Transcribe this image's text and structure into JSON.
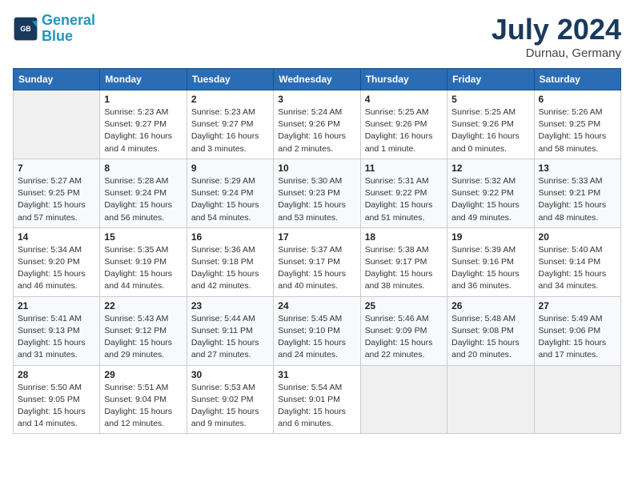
{
  "header": {
    "logo_line1": "General",
    "logo_line2": "Blue",
    "month_year": "July 2024",
    "location": "Durnau, Germany"
  },
  "columns": [
    "Sunday",
    "Monday",
    "Tuesday",
    "Wednesday",
    "Thursday",
    "Friday",
    "Saturday"
  ],
  "weeks": [
    [
      {
        "day": "",
        "info": ""
      },
      {
        "day": "1",
        "info": "Sunrise: 5:23 AM\nSunset: 9:27 PM\nDaylight: 16 hours\nand 4 minutes."
      },
      {
        "day": "2",
        "info": "Sunrise: 5:23 AM\nSunset: 9:27 PM\nDaylight: 16 hours\nand 3 minutes."
      },
      {
        "day": "3",
        "info": "Sunrise: 5:24 AM\nSunset: 9:26 PM\nDaylight: 16 hours\nand 2 minutes."
      },
      {
        "day": "4",
        "info": "Sunrise: 5:25 AM\nSunset: 9:26 PM\nDaylight: 16 hours\nand 1 minute."
      },
      {
        "day": "5",
        "info": "Sunrise: 5:25 AM\nSunset: 9:26 PM\nDaylight: 16 hours\nand 0 minutes."
      },
      {
        "day": "6",
        "info": "Sunrise: 5:26 AM\nSunset: 9:25 PM\nDaylight: 15 hours\nand 58 minutes."
      }
    ],
    [
      {
        "day": "7",
        "info": "Sunrise: 5:27 AM\nSunset: 9:25 PM\nDaylight: 15 hours\nand 57 minutes."
      },
      {
        "day": "8",
        "info": "Sunrise: 5:28 AM\nSunset: 9:24 PM\nDaylight: 15 hours\nand 56 minutes."
      },
      {
        "day": "9",
        "info": "Sunrise: 5:29 AM\nSunset: 9:24 PM\nDaylight: 15 hours\nand 54 minutes."
      },
      {
        "day": "10",
        "info": "Sunrise: 5:30 AM\nSunset: 9:23 PM\nDaylight: 15 hours\nand 53 minutes."
      },
      {
        "day": "11",
        "info": "Sunrise: 5:31 AM\nSunset: 9:22 PM\nDaylight: 15 hours\nand 51 minutes."
      },
      {
        "day": "12",
        "info": "Sunrise: 5:32 AM\nSunset: 9:22 PM\nDaylight: 15 hours\nand 49 minutes."
      },
      {
        "day": "13",
        "info": "Sunrise: 5:33 AM\nSunset: 9:21 PM\nDaylight: 15 hours\nand 48 minutes."
      }
    ],
    [
      {
        "day": "14",
        "info": "Sunrise: 5:34 AM\nSunset: 9:20 PM\nDaylight: 15 hours\nand 46 minutes."
      },
      {
        "day": "15",
        "info": "Sunrise: 5:35 AM\nSunset: 9:19 PM\nDaylight: 15 hours\nand 44 minutes."
      },
      {
        "day": "16",
        "info": "Sunrise: 5:36 AM\nSunset: 9:18 PM\nDaylight: 15 hours\nand 42 minutes."
      },
      {
        "day": "17",
        "info": "Sunrise: 5:37 AM\nSunset: 9:17 PM\nDaylight: 15 hours\nand 40 minutes."
      },
      {
        "day": "18",
        "info": "Sunrise: 5:38 AM\nSunset: 9:17 PM\nDaylight: 15 hours\nand 38 minutes."
      },
      {
        "day": "19",
        "info": "Sunrise: 5:39 AM\nSunset: 9:16 PM\nDaylight: 15 hours\nand 36 minutes."
      },
      {
        "day": "20",
        "info": "Sunrise: 5:40 AM\nSunset: 9:14 PM\nDaylight: 15 hours\nand 34 minutes."
      }
    ],
    [
      {
        "day": "21",
        "info": "Sunrise: 5:41 AM\nSunset: 9:13 PM\nDaylight: 15 hours\nand 31 minutes."
      },
      {
        "day": "22",
        "info": "Sunrise: 5:43 AM\nSunset: 9:12 PM\nDaylight: 15 hours\nand 29 minutes."
      },
      {
        "day": "23",
        "info": "Sunrise: 5:44 AM\nSunset: 9:11 PM\nDaylight: 15 hours\nand 27 minutes."
      },
      {
        "day": "24",
        "info": "Sunrise: 5:45 AM\nSunset: 9:10 PM\nDaylight: 15 hours\nand 24 minutes."
      },
      {
        "day": "25",
        "info": "Sunrise: 5:46 AM\nSunset: 9:09 PM\nDaylight: 15 hours\nand 22 minutes."
      },
      {
        "day": "26",
        "info": "Sunrise: 5:48 AM\nSunset: 9:08 PM\nDaylight: 15 hours\nand 20 minutes."
      },
      {
        "day": "27",
        "info": "Sunrise: 5:49 AM\nSunset: 9:06 PM\nDaylight: 15 hours\nand 17 minutes."
      }
    ],
    [
      {
        "day": "28",
        "info": "Sunrise: 5:50 AM\nSunset: 9:05 PM\nDaylight: 15 hours\nand 14 minutes."
      },
      {
        "day": "29",
        "info": "Sunrise: 5:51 AM\nSunset: 9:04 PM\nDaylight: 15 hours\nand 12 minutes."
      },
      {
        "day": "30",
        "info": "Sunrise: 5:53 AM\nSunset: 9:02 PM\nDaylight: 15 hours\nand 9 minutes."
      },
      {
        "day": "31",
        "info": "Sunrise: 5:54 AM\nSunset: 9:01 PM\nDaylight: 15 hours\nand 6 minutes."
      },
      {
        "day": "",
        "info": ""
      },
      {
        "day": "",
        "info": ""
      },
      {
        "day": "",
        "info": ""
      }
    ]
  ]
}
